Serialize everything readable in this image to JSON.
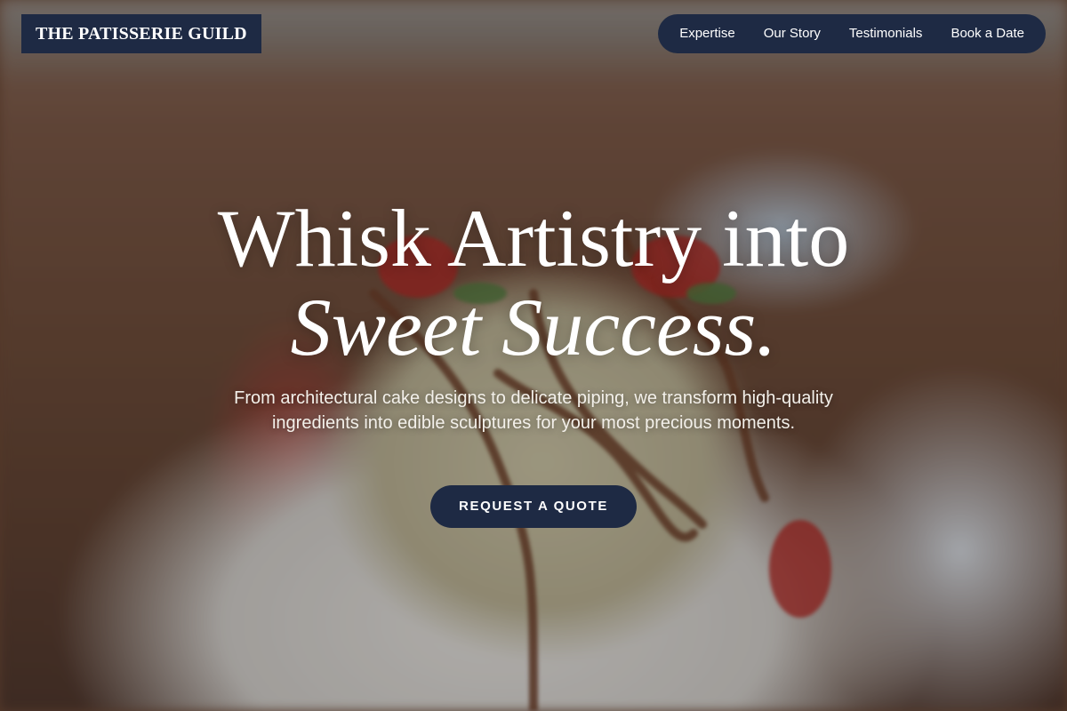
{
  "brand": {
    "logo_text": "THE PATISSERIE GUILD"
  },
  "nav": {
    "items": [
      {
        "label": "Expertise"
      },
      {
        "label": "Our Story"
      },
      {
        "label": "Testimonials"
      },
      {
        "label": "Book a Date"
      }
    ]
  },
  "hero": {
    "headline_line1": "Whisk Artistry into",
    "headline_line2": "Sweet Success.",
    "subtitle": "From architectural cake designs to delicate piping, we transform high-quality ingredients into edible sculptures for your most precious moments.",
    "cta_label": "REQUEST A QUOTE"
  },
  "colors": {
    "accent_navy": "#1e2a44",
    "text_white": "#ffffff"
  }
}
